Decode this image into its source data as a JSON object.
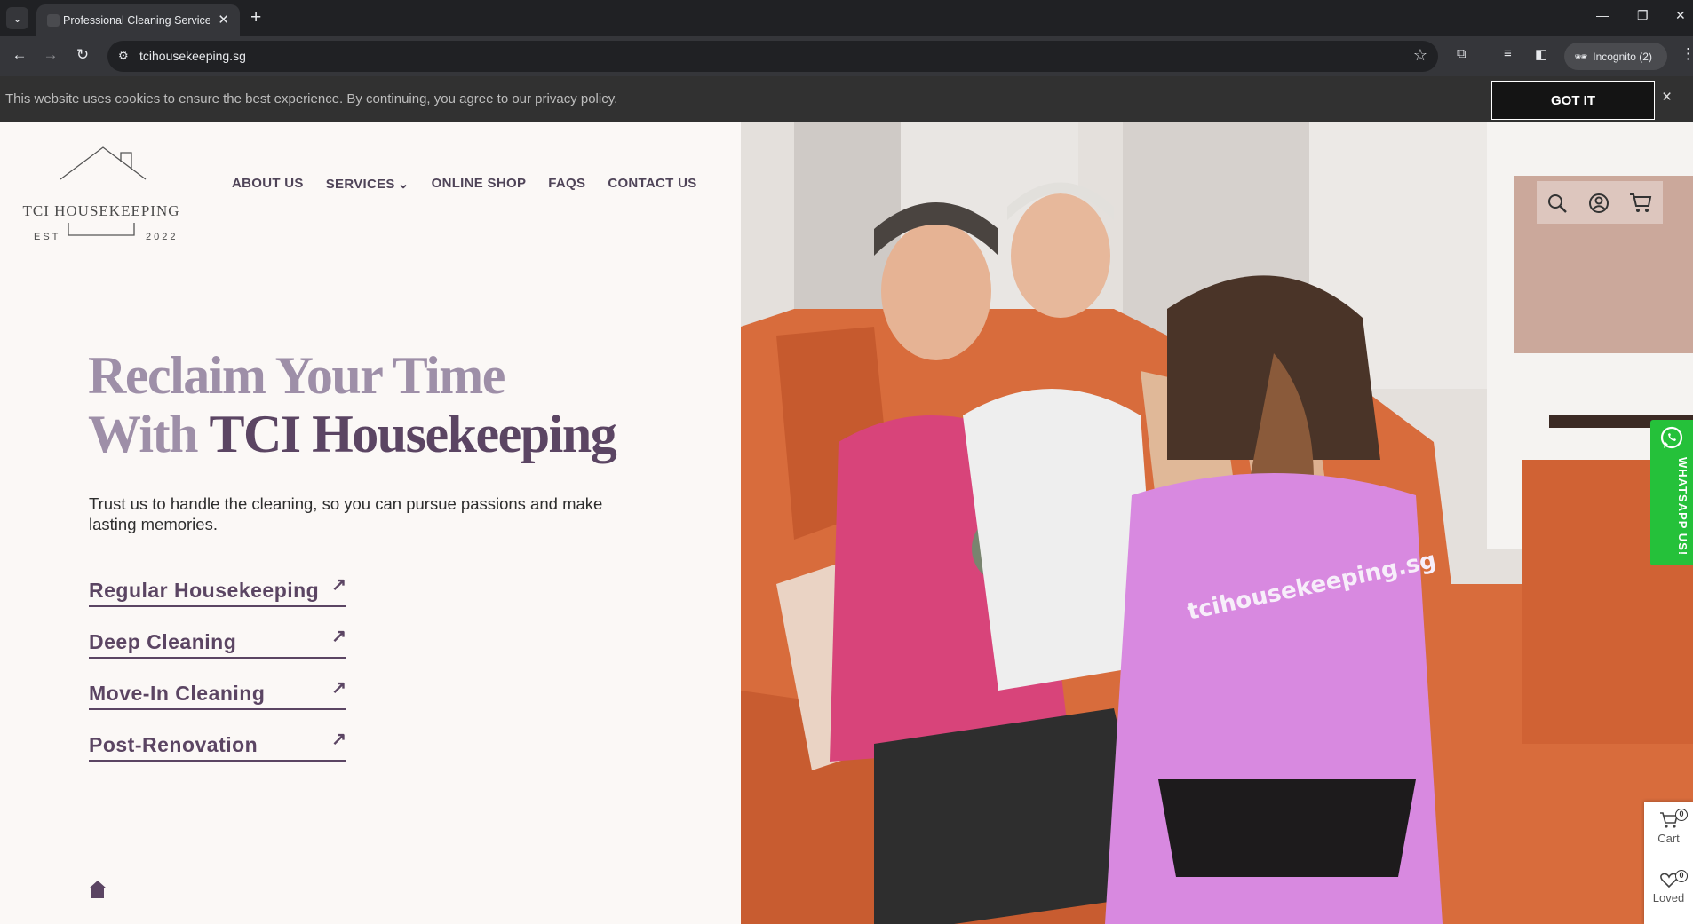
{
  "browser": {
    "tab_title": "Professional Cleaning Services",
    "new_tab": "+",
    "url": "tcihousekeeping.sg",
    "incognito": "Incognito (2)"
  },
  "cookie": {
    "text": "This website uses cookies to ensure the best experience. By continuing, you agree to our privacy policy.",
    "button": "GOT IT",
    "close": "×"
  },
  "logo": {
    "name": "TCI HOUSEKEEPING",
    "est": "EST",
    "year": "2022"
  },
  "nav": {
    "items": [
      "ABOUT US",
      "SERVICES",
      "ONLINE SHOP",
      "FAQS",
      "CONTACT US"
    ]
  },
  "hero": {
    "line1": "Reclaim Your Time",
    "line2_light": "With",
    "line2_dark": "TCI Housekeeping",
    "subtext": "Trust us to handle the cleaning, so you can pursue passions and make lasting memories.",
    "services": [
      "Regular Housekeeping",
      "Deep Cleaning",
      "Move-In Cleaning",
      "Post-Renovation"
    ],
    "arrow": "↗"
  },
  "photo": {
    "shirt_text": "tcihousekeeping.sg"
  },
  "widgets": {
    "whatsapp": "WHATSAPP US!",
    "cart_label": "Cart",
    "cart_count": "0",
    "loved_label": "Loved",
    "loved_count": "0"
  },
  "colors": {
    "accent_dark": "#5b4563",
    "accent_light": "#9e8fa8",
    "whatsapp_green": "#25c13a",
    "cookie_bar": "#313131"
  }
}
